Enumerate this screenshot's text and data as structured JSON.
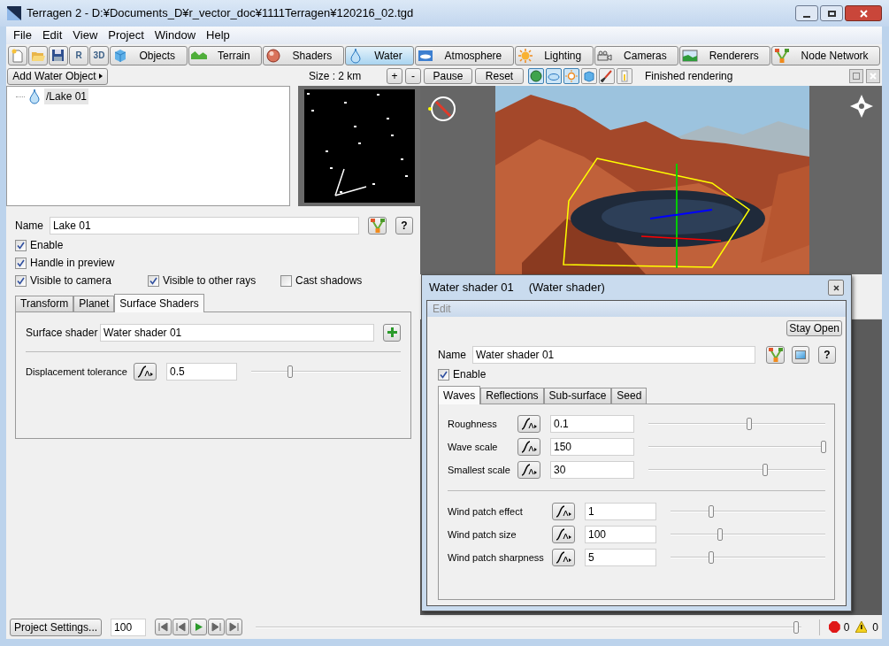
{
  "window": {
    "title": "Terragen 2 - D:¥Documents_D¥r_vector_doc¥1111Terragen¥120216_02.tgd"
  },
  "menu": [
    "File",
    "Edit",
    "View",
    "Project",
    "Window",
    "Help"
  ],
  "toolbar": {
    "icon_buttons": [
      {
        "kind": "new"
      },
      {
        "kind": "open"
      },
      {
        "kind": "save"
      },
      {
        "kind": "render",
        "label": "R"
      },
      {
        "kind": "view3d",
        "label": "3D"
      }
    ],
    "tabs": [
      {
        "label": "Objects",
        "kind": "cube",
        "selected": false
      },
      {
        "label": "Terrain",
        "kind": "hill",
        "selected": false
      },
      {
        "label": "Shaders",
        "kind": "sphere",
        "selected": false
      },
      {
        "label": "Water",
        "kind": "drop",
        "selected": true
      },
      {
        "label": "Atmosphere",
        "kind": "sky",
        "selected": false
      },
      {
        "label": "Lighting",
        "kind": "sun",
        "selected": false
      },
      {
        "label": "Cameras",
        "kind": "camera",
        "selected": false
      },
      {
        "label": "Renderers",
        "kind": "landscape",
        "selected": false
      },
      {
        "label": "Node Network",
        "kind": "node",
        "selected": false
      }
    ]
  },
  "objects": {
    "add_button": "Add Water Object",
    "help": "?",
    "tree": [
      {
        "label": "/Lake 01",
        "selected": true
      }
    ]
  },
  "preview": {
    "size": "Size : 2 km",
    "buttons": [
      "+",
      "-",
      "Pause",
      "Reset"
    ],
    "tools": [
      {
        "kind": "globe",
        "selected": true
      },
      {
        "kind": "cloud",
        "selected": true
      },
      {
        "kind": "sun",
        "selected": true
      },
      {
        "kind": "cube",
        "selected": false
      },
      {
        "kind": "brush",
        "selected": false
      },
      {
        "kind": "meter",
        "selected": false
      }
    ],
    "status": "Finished rendering"
  },
  "properties": {
    "name_label": "Name",
    "name_value": "Lake 01",
    "checkboxes": [
      {
        "label": "Enable",
        "checked": true
      },
      {
        "label": "Handle in preview",
        "checked": true
      }
    ],
    "visibility": [
      {
        "label": "Visible to camera",
        "checked": true
      },
      {
        "label": "Visible to other rays",
        "checked": true
      },
      {
        "label": "Cast shadows",
        "checked": false
      }
    ],
    "tabs": [
      {
        "label": "Transform",
        "selected": false
      },
      {
        "label": "Planet",
        "selected": false
      },
      {
        "label": "Surface Shaders",
        "selected": true
      }
    ],
    "surface_shader": {
      "label": "Surface shader",
      "value": "Water shader 01"
    },
    "params": [
      {
        "label": "Displacement tolerance",
        "value": "0.5",
        "level": 0.26
      }
    ]
  },
  "dialog": {
    "title": "Water shader 01",
    "subtitle": "(Water shader)",
    "menu": [
      "Edit"
    ],
    "stay_open": "Stay Open",
    "name_label": "Name",
    "name_value": "Water shader 01",
    "help": "?",
    "enable": {
      "label": "Enable",
      "checked": true
    },
    "tabs": [
      {
        "label": "Waves",
        "selected": true
      },
      {
        "label": "Reflections",
        "selected": false
      },
      {
        "label": "Sub-surface",
        "selected": false
      },
      {
        "label": "Seed",
        "selected": false
      }
    ],
    "groups": [
      [
        {
          "label": "Roughness",
          "value": "0.1",
          "level": 0.57
        },
        {
          "label": "Wave scale",
          "value": "150",
          "level": 0.99
        },
        {
          "label": "Smallest scale",
          "value": "30",
          "level": 0.66
        }
      ],
      [
        {
          "label": "Wind patch effect",
          "value": "1",
          "level": 0.26
        },
        {
          "label": "Wind patch size",
          "value": "100",
          "level": 0.32
        },
        {
          "label": "Wind patch sharpness",
          "value": "5",
          "level": 0.26
        }
      ]
    ]
  },
  "bottom": {
    "project_settings": "Project Settings...",
    "frame": "100",
    "timeline": {
      "level": 0.99
    },
    "errors": "0",
    "warnings": "0"
  }
}
